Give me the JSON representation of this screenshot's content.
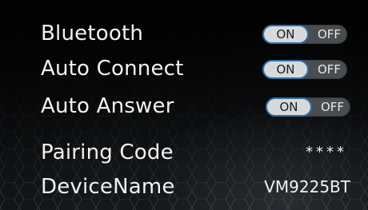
{
  "settings": [
    {
      "label": "Bluetooth",
      "on": "ON",
      "off": "OFF"
    },
    {
      "label": "Auto Connect",
      "on": "ON",
      "off": "OFF"
    },
    {
      "label": "Auto Answer",
      "on": "ON",
      "off": "OFF"
    },
    {
      "label": "Pairing Code",
      "value": "****"
    },
    {
      "label": "DeviceName",
      "value": "VM9225BT"
    }
  ],
  "colors": {
    "toggle_on_border": "#2f6ea8",
    "toggle_on_fill": "#d7dadd",
    "toggle_off_fill": "#4a4d50",
    "text": "#f2f2f2"
  }
}
